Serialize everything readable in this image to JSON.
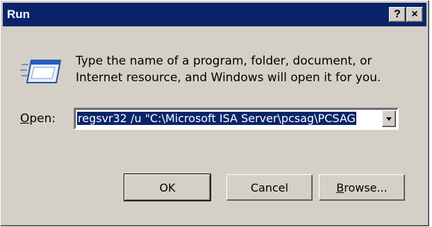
{
  "window": {
    "title": "Run",
    "help_label": "?",
    "close_label": "×"
  },
  "body": {
    "instructions": "Type the name of a program, folder, document, or Internet resource, and Windows will open it for you.",
    "icon": "run-window-icon"
  },
  "open": {
    "label_mnemonic": "O",
    "label_rest": "pen:",
    "value": "regsvr32 /u  \"C:\\Microsoft ISA Server\\pcsag\\PCSAG"
  },
  "buttons": {
    "ok": "OK",
    "cancel": "Cancel",
    "browse_mnemonic": "B",
    "browse_rest": "rowse..."
  }
}
